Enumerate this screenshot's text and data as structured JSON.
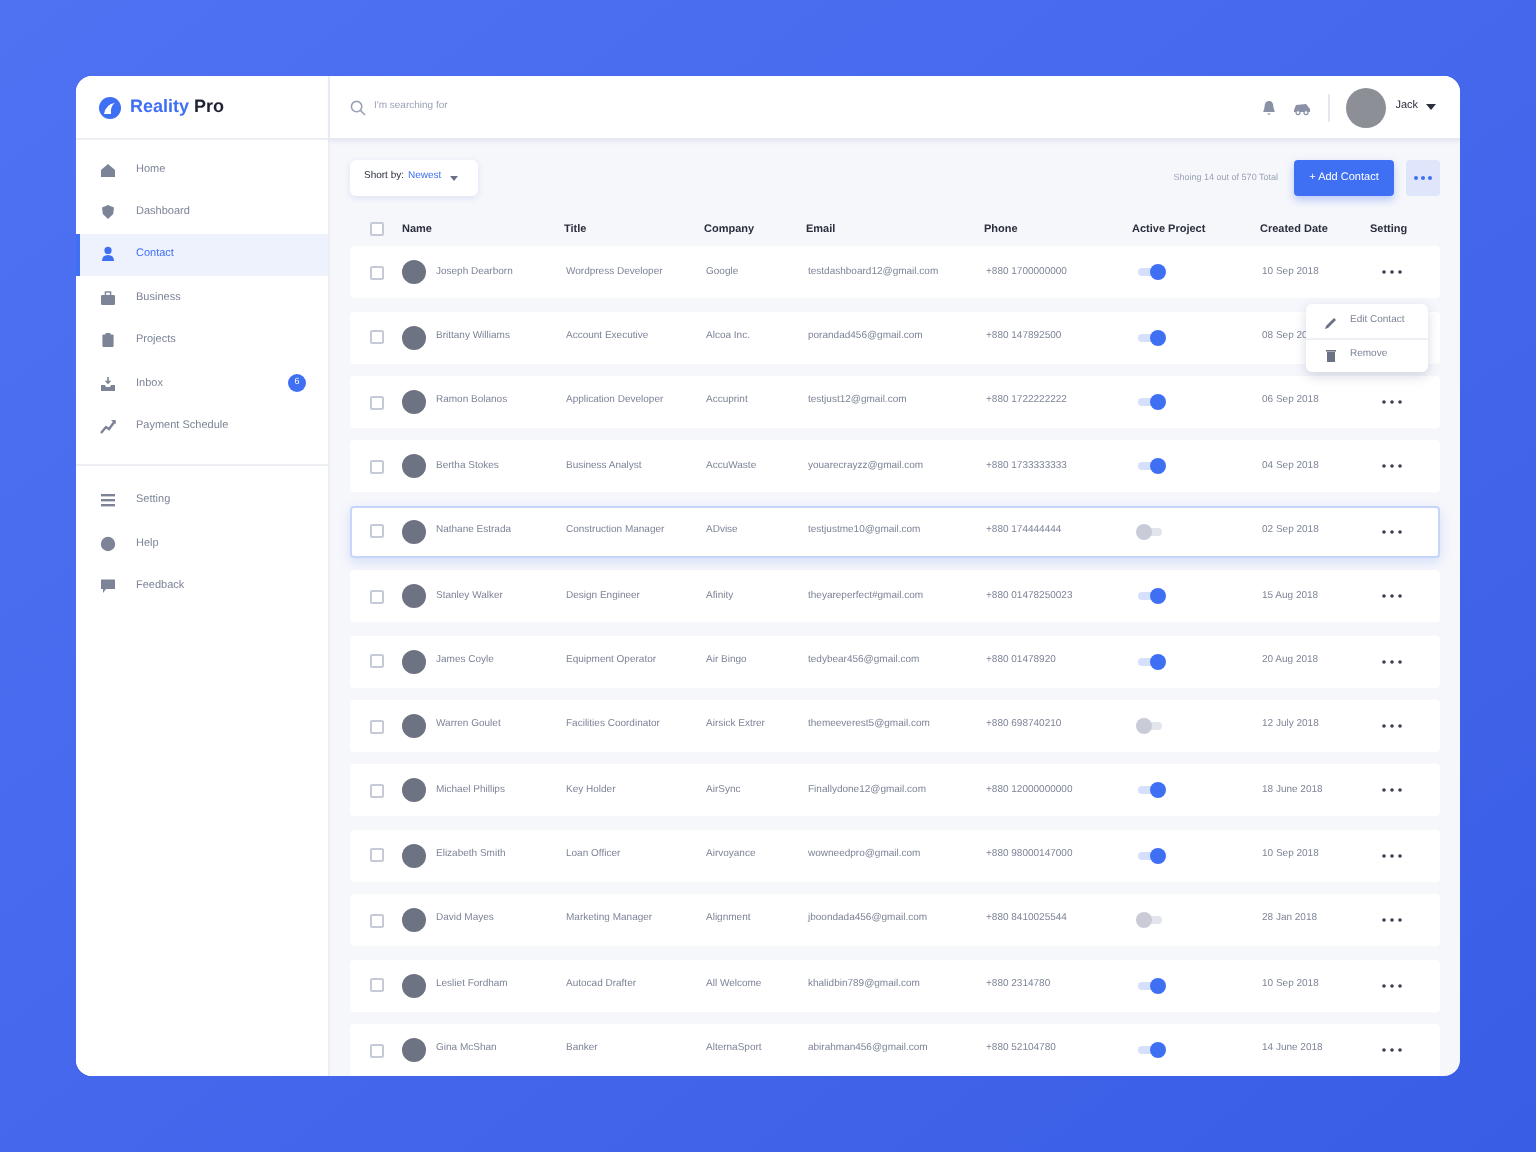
{
  "brand": {
    "name": "Reality",
    "suffix": "Pro"
  },
  "search": {
    "placeholder": "I'm searching for"
  },
  "user": {
    "name": "Jack"
  },
  "sidebar": {
    "groups": [
      [
        {
          "label": "Home",
          "selected": false
        },
        {
          "label": "Dashboard",
          "selected": false
        },
        {
          "label": "Contact",
          "selected": true
        },
        {
          "label": "Business",
          "selected": false
        },
        {
          "label": "Projects",
          "selected": false
        },
        {
          "label": "Inbox",
          "selected": false,
          "badge": "6"
        },
        {
          "label": "Payment Schedule",
          "selected": false
        }
      ],
      [
        {
          "label": "Setting",
          "selected": false
        },
        {
          "label": "Help",
          "selected": false
        },
        {
          "label": "Feedback",
          "selected": false
        }
      ]
    ]
  },
  "toolbar": {
    "sort_label": "Short by:",
    "sort_value": "Newest",
    "summary": "Shoing 14 out of 570 Total",
    "add_button": "+ Add Contact"
  },
  "table": {
    "select_all_checked": false,
    "columns": [
      "Name",
      "Title",
      "Company",
      "Email",
      "Phone",
      "Active Project",
      "Created Date",
      "Setting"
    ],
    "rows": [
      {
        "checked": false,
        "selected": false,
        "name": "Joseph Dearborn",
        "title": "Wordpress Developer",
        "company": "Google",
        "email": "testdashboard12@gmail.com",
        "phone": "+880 1700000000",
        "active": true,
        "date": "10 Sep 2018"
      },
      {
        "checked": false,
        "selected": false,
        "name": "Brittany Williams",
        "title": "Account Executive",
        "company": "Alcoa Inc.",
        "email": "porandad456@gmail.com",
        "phone": "+880 147892500",
        "active": true,
        "date": "08 Sep 20"
      },
      {
        "checked": false,
        "selected": false,
        "name": "Ramon Bolanos",
        "title": "Application Developer",
        "company": "Accuprint",
        "email": "testjust12@gmail.com",
        "phone": "+880 1722222222",
        "active": true,
        "date": "06 Sep 2018"
      },
      {
        "checked": false,
        "selected": false,
        "name": "Bertha Stokes",
        "title": "Business Analyst",
        "company": "AccuWaste",
        "email": "youarecrayzz@gmail.com",
        "phone": "+880 1733333333",
        "active": true,
        "date": "04 Sep 2018"
      },
      {
        "checked": false,
        "selected": true,
        "name": "Nathane Estrada",
        "title": "Construction Manager",
        "company": "ADvise",
        "email": "testjustme10@gmail.com",
        "phone": "+880 174444444",
        "active": false,
        "date": "02 Sep 2018"
      },
      {
        "checked": false,
        "selected": false,
        "name": "Stanley Walker",
        "title": "Design Engineer",
        "company": "Afinity",
        "email": "theyareperfect#gmail.com",
        "phone": "+880 01478250023",
        "active": true,
        "date": "15 Aug 2018"
      },
      {
        "checked": false,
        "selected": false,
        "name": "James Coyle",
        "title": "Equipment Operator",
        "company": "Air Bingo",
        "email": "tedybear456@gmail.com",
        "phone": "+880 01478920",
        "active": true,
        "date": "20 Aug 2018"
      },
      {
        "checked": false,
        "selected": false,
        "name": "Warren Goulet",
        "title": "Facilities Coordinator",
        "company": "Airsick Extrer",
        "email": "themeeverest5@gmail.com",
        "phone": "+880 698740210",
        "active": false,
        "date": "12 July 2018"
      },
      {
        "checked": false,
        "selected": false,
        "name": "Michael Phillips",
        "title": "Key Holder",
        "company": "AirSync",
        "email": "Finallydone12@gmail.com",
        "phone": "+880 12000000000",
        "active": true,
        "date": "18 June 2018"
      },
      {
        "checked": false,
        "selected": false,
        "name": "Elizabeth Smith",
        "title": "Loan Officer",
        "company": "Airvoyance",
        "email": "wowneedpro@gmail.com",
        "phone": "+880 98000147000",
        "active": true,
        "date": "10 Sep 2018"
      },
      {
        "checked": false,
        "selected": false,
        "name": "David Mayes",
        "title": "Marketing Manager",
        "company": "Alignment",
        "email": "jboondada456@gmail.com",
        "phone": "+880 8410025544",
        "active": false,
        "date": "28 Jan 2018"
      },
      {
        "checked": false,
        "selected": false,
        "name": "Lesliet Fordham",
        "title": "Autocad Drafter",
        "company": "All Welcome",
        "email": "khalidbin789@gmail.com",
        "phone": "+880 2314780",
        "active": true,
        "date": "10 Sep 2018"
      },
      {
        "checked": false,
        "selected": false,
        "name": "Gina McShan",
        "title": "Banker",
        "company": "AlternaSport",
        "email": "abirahman456@gmail.com",
        "phone": "+880 52104780",
        "active": true,
        "date": "14 June 2018"
      }
    ]
  },
  "row_menu": {
    "items": [
      {
        "label": "Edit Contact"
      },
      {
        "label": "Remove"
      }
    ]
  }
}
